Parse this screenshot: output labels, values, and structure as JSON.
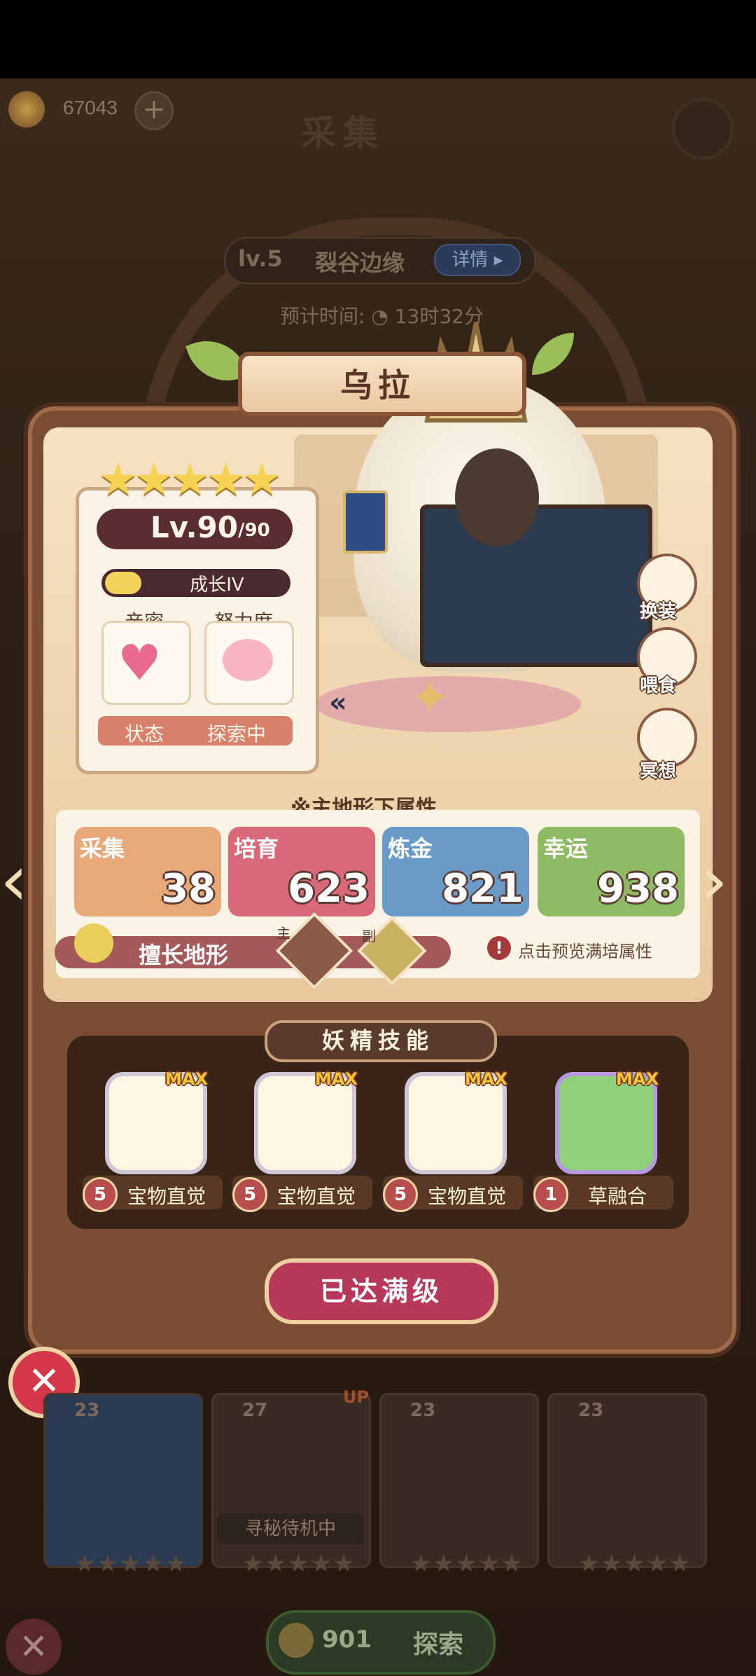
{
  "header": {
    "coins": "67043",
    "title": "采集"
  },
  "location": {
    "level": "lv.5",
    "name": "裂谷边缘",
    "detail": "详情"
  },
  "eta": {
    "label": "预计时间:",
    "value": "13时32分"
  },
  "fairy": {
    "name": "乌拉",
    "stars": "★★★★★",
    "level": "Lv.90",
    "level_max": "/90",
    "growth": "成长IV",
    "growth_fraction": 0.2,
    "affinity_label": "亲密",
    "effort_label": "努力度",
    "status_label": "状态",
    "status_value": "探索中"
  },
  "actions": {
    "dress": "换装",
    "feed": "喂食",
    "meditate": "冥想"
  },
  "attributes": {
    "title": "※主地形下属性",
    "items": [
      {
        "label": "采集",
        "value": "38"
      },
      {
        "label": "培育",
        "value": "623"
      },
      {
        "label": "炼金",
        "value": "821"
      },
      {
        "label": "幸运",
        "value": "938"
      }
    ],
    "terrain_label": "擅长地形",
    "main_tag": "主",
    "sub_tag": "副",
    "preview_text": "点击预览满培属性"
  },
  "skills": {
    "title": "妖精技能",
    "max_tag": "MAX",
    "items": [
      {
        "level": "5",
        "name": "宝物直觉"
      },
      {
        "level": "5",
        "name": "宝物直觉"
      },
      {
        "level": "5",
        "name": "宝物直觉"
      },
      {
        "level": "1",
        "name": "草融合"
      }
    ]
  },
  "max_button": "已达满级",
  "lower_cards": {
    "nums": [
      "23",
      "27",
      "23",
      "23"
    ],
    "seek_label": "寻秘待机中",
    "up_label": "UP"
  },
  "explore": {
    "count": "901",
    "label": "探索"
  },
  "colors": {
    "panel": "#7a4c34",
    "gather": "#e8a878",
    "nurture": "#d8687a",
    "alchemy": "#6a9ac8",
    "luck": "#8fba64",
    "max_button": "#b8385a"
  }
}
